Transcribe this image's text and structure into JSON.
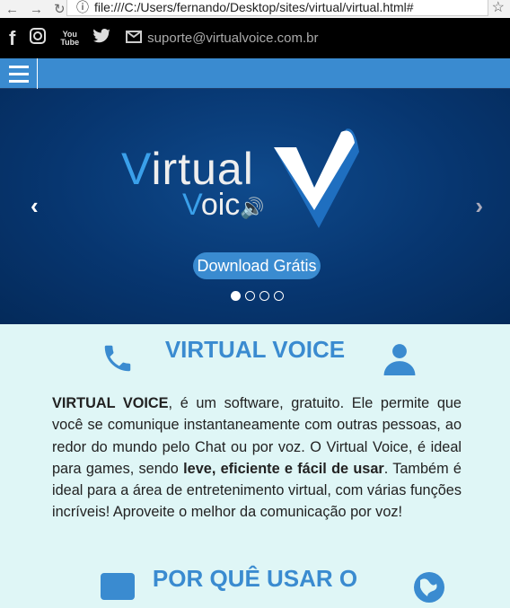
{
  "browser": {
    "url": "file:///C:/Users/fernando/Desktop/sites/virtual/virtual.html#"
  },
  "topbar": {
    "email": "suporte@virtualvoice.com.br",
    "icons": [
      "facebook-icon",
      "instagram-icon",
      "youtube-icon",
      "twitter-icon",
      "envelope-icon"
    ]
  },
  "hero": {
    "logo_line1": "Virtual",
    "logo_line2": "Voic",
    "button": "Download Grátis",
    "slides": 4,
    "active_slide": 1
  },
  "section1": {
    "title": "VIRTUAL VOICE",
    "p_bold1": "VIRTUAL VOICE",
    "p_text1": ", é um software, gratuito. Ele permite que você se comunique instantaneamente com outras pessoas, ao redor do mundo pelo Chat ou por voz. O Virtual Voice, é ideal para games, sendo ",
    "p_bold2": "leve, eficiente e fácil de usar",
    "p_text2": ". Também é ideal para a área de entretenimento virtual, com várias funções incríveis! Aproveite o melhor da comunicação por voz!"
  },
  "section2": {
    "title": "POR QUÊ USAR O"
  },
  "colors": {
    "accent": "#3a8bd0",
    "hero": "#073670",
    "content_bg": "#dff6f6"
  }
}
